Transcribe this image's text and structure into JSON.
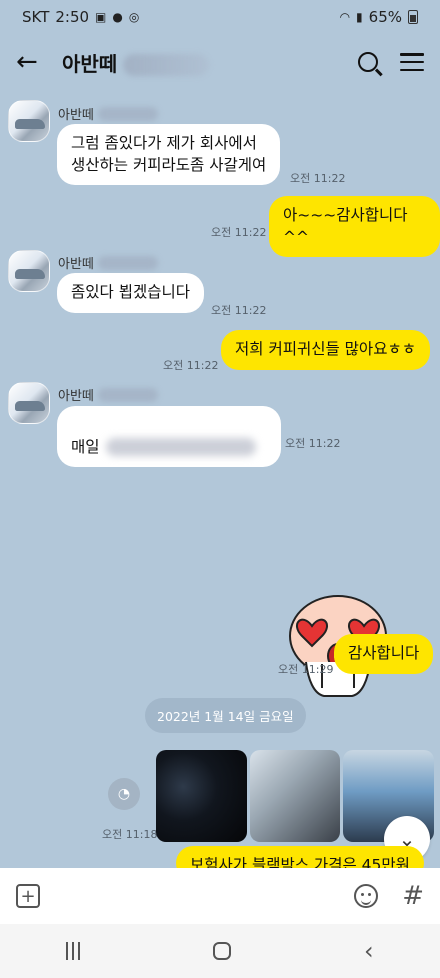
{
  "status_bar": {
    "carrier": "SKT",
    "time": "2:50",
    "battery": "65%"
  },
  "header": {
    "title": "아반떼",
    "back_icon": "arrow-left-icon",
    "search_icon": "search-icon",
    "menu_icon": "hamburger-menu-icon"
  },
  "messages": [
    {
      "sender": "아반떼",
      "text": "그럼 좀있다가 제가 회사에서\n생산하는 커피라도좀 사갈게여",
      "time": "오전 11:22"
    },
    {
      "me": true,
      "text": "아~~~감사합니다^^",
      "time": "오전 11:22"
    },
    {
      "sender": "아반떼",
      "text": "좀있다 뵙겠습니다",
      "time": "오전 11:22"
    },
    {
      "me": true,
      "text": "저희 커피귀신들 많아요ㅎㅎ",
      "time": "오전 11:22"
    },
    {
      "sender": "아반떼",
      "text": "매일",
      "time": "오전 11:22"
    },
    {
      "me": true,
      "text": "감사합니다",
      "time": "오전 11:29"
    },
    {
      "me": true,
      "text": "보험사가 블랙박스 가격은 45만원"
    }
  ],
  "date_divider": "2022년 1월 14일 금요일",
  "photos_time": "오전 11:18",
  "input_bar": {
    "plus_icon": "plus-icon",
    "emoji_icon": "emoji-icon",
    "hash_label": "#"
  }
}
